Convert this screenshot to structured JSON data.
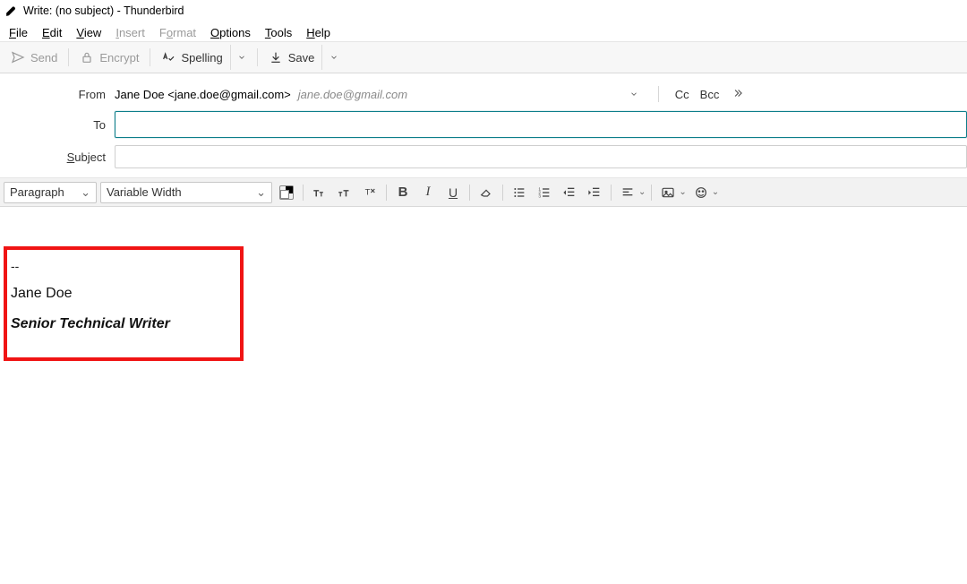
{
  "window": {
    "title": "Write: (no subject) - Thunderbird"
  },
  "menu": {
    "file": {
      "label": "File",
      "accel": "F"
    },
    "edit": {
      "label": "Edit",
      "accel": "E"
    },
    "view": {
      "label": "View",
      "accel": "V"
    },
    "insert": {
      "label": "Insert",
      "accel": "I",
      "disabled": true
    },
    "format": {
      "label": "Format",
      "accel": "o",
      "disabled": true
    },
    "options": {
      "label": "Options",
      "accel": "O"
    },
    "tools": {
      "label": "Tools",
      "accel": "T"
    },
    "help": {
      "label": "Help",
      "accel": "H"
    }
  },
  "toolbar": {
    "send": {
      "label": "Send",
      "disabled": true
    },
    "encrypt": {
      "label": "Encrypt",
      "disabled": true
    },
    "spelling": {
      "label": "Spelling"
    },
    "save": {
      "label": "Save"
    }
  },
  "address": {
    "fromLabel": "From",
    "fromValue": "Jane Doe <jane.doe@gmail.com>",
    "fromAccount": "jane.doe@gmail.com",
    "cc": "Cc",
    "bcc": "Bcc",
    "toLabel": "To",
    "toValue": "",
    "subjectLabel": "Subject",
    "subjectAccel": "S",
    "subjectValue": ""
  },
  "format": {
    "paragraph": "Paragraph",
    "font": "Variable Width"
  },
  "signature": {
    "sep": "--",
    "name": "Jane Doe",
    "title": "Senior Technical Writer"
  }
}
